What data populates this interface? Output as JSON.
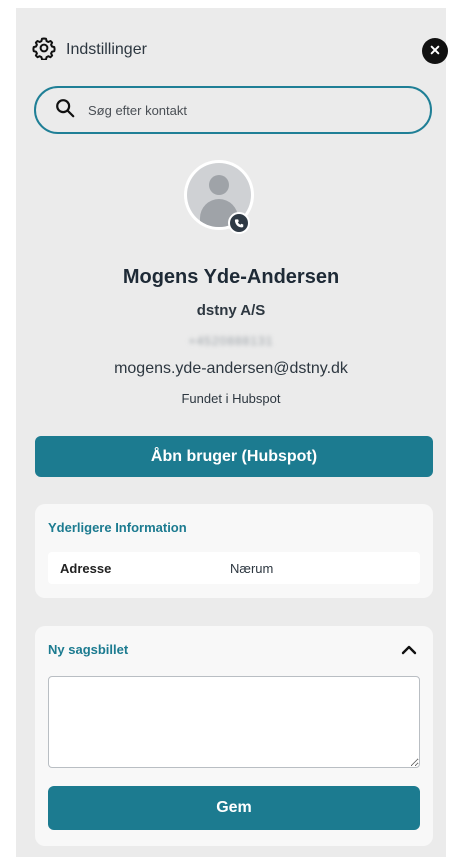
{
  "header": {
    "settings_label": "Indstillinger",
    "settings_icon": "gear-icon",
    "close_icon": "close-icon"
  },
  "search": {
    "placeholder": "Søg efter kontakt",
    "icon": "search-icon"
  },
  "contact": {
    "name": "Mogens Yde-Andersen",
    "company": "dstny A/S",
    "phone": "+4520888131",
    "email": "mogens.yde-andersen@dstny.dk",
    "found_in": "Fundet i Hubspot",
    "avatar_icon": "user-placeholder-icon",
    "status_icon": "phone-status-icon"
  },
  "actions": {
    "open_user_label": "Åbn bruger (Hubspot)"
  },
  "additional_info": {
    "title": "Yderligere Information",
    "rows": [
      {
        "key": "Adresse",
        "value": "Nærum"
      }
    ]
  },
  "ticket": {
    "title": "Ny sagsbillet",
    "textarea_value": "",
    "save_label": "Gem",
    "collapse_icon": "chevron-up-icon"
  },
  "colors": {
    "accent": "#1c7b90",
    "panel_bg": "#ebebeb",
    "card_bg": "#f8f8f8",
    "dark": "#111111"
  }
}
